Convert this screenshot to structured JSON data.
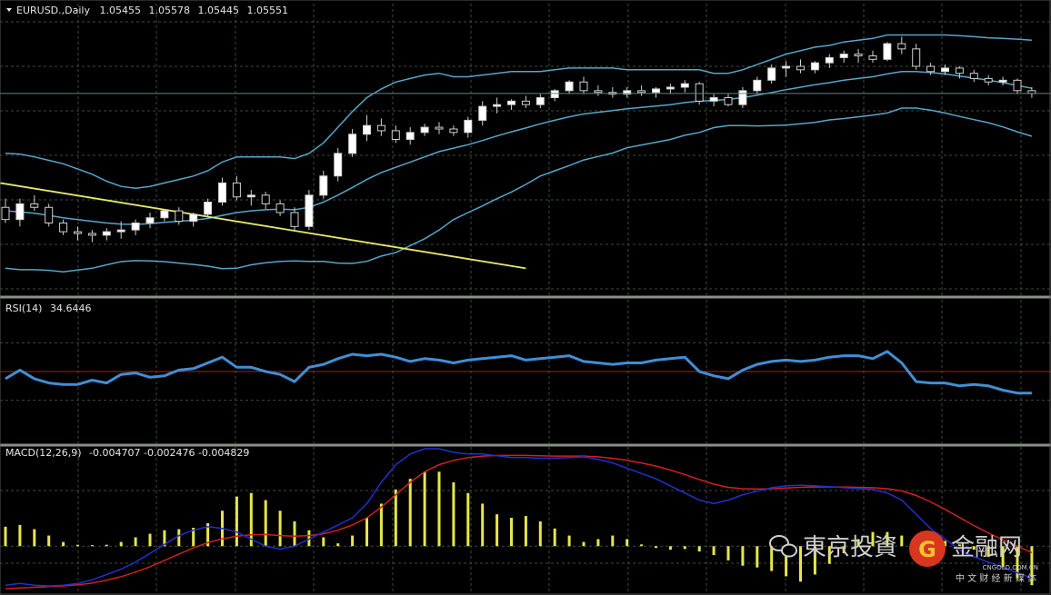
{
  "colors": {
    "background": "#000000",
    "grid": "#3c4a3c",
    "separator": "#8a8f8a",
    "bull_candle": "#ffffff",
    "bear_candle": "#000000",
    "wick": "#cfcfcf",
    "bollinger": "#56a6c9",
    "trendline": "#e6e66a",
    "rsi_line": "#3f8fd6",
    "rsi_level": "#b11b1b",
    "macd_hist": "#e6e64a",
    "macd_main": "#2030d0",
    "macd_signal": "#d02020"
  },
  "header": {
    "symbol_text": "EURUSD.,Daily",
    "open": "1.05455",
    "high": "1.05578",
    "low": "1.05445",
    "close": "1.05551"
  },
  "rsi_header": {
    "label": "RSI(14)",
    "value": "34.6446"
  },
  "macd_header": {
    "label": "MACD(12,26,9)",
    "values": "-0.004707 -0.002476 -0.004829"
  },
  "watermark": {
    "text_left": "東京投資",
    "text_right": "金融网",
    "site": "CNGOLD.COM.CN",
    "slogan": "中 文 财 经 新 媒 体",
    "icon": "wechat-icon"
  },
  "chart_data": [
    {
      "type": "candlestick",
      "panel": "price",
      "x_count": 72,
      "ylim": [
        1.028,
        1.112
      ],
      "candles": [
        [
          1.0535,
          1.056,
          1.049,
          1.05
        ],
        [
          1.05,
          1.056,
          1.048,
          1.0545
        ],
        [
          1.0545,
          1.057,
          1.0525,
          1.0535
        ],
        [
          1.0535,
          1.0545,
          1.048,
          1.049
        ],
        [
          1.049,
          1.05,
          1.0455,
          1.0465
        ],
        [
          1.0465,
          1.048,
          1.044,
          1.046
        ],
        [
          1.046,
          1.047,
          1.0435,
          1.0455
        ],
        [
          1.0455,
          1.0475,
          1.044,
          1.0465
        ],
        [
          1.0465,
          1.0495,
          1.0445,
          1.047
        ],
        [
          1.047,
          1.05,
          1.0455,
          1.049
        ],
        [
          1.049,
          1.052,
          1.0475,
          1.0505
        ],
        [
          1.0505,
          1.053,
          1.0495,
          1.0525
        ],
        [
          1.0525,
          1.0535,
          1.0485,
          1.0495
        ],
        [
          1.0495,
          1.052,
          1.048,
          1.0515
        ],
        [
          1.0515,
          1.056,
          1.0505,
          1.055
        ],
        [
          1.055,
          1.062,
          1.054,
          1.0605
        ],
        [
          1.0605,
          1.0625,
          1.0555,
          1.0565
        ],
        [
          1.0565,
          1.0585,
          1.054,
          1.057
        ],
        [
          1.057,
          1.058,
          1.053,
          1.0545
        ],
        [
          1.0545,
          1.0555,
          1.051,
          1.052
        ],
        [
          1.052,
          1.0535,
          1.047,
          1.048
        ],
        [
          1.048,
          1.0585,
          1.047,
          1.057
        ],
        [
          1.057,
          1.064,
          1.056,
          1.0625
        ],
        [
          1.0625,
          1.0705,
          1.061,
          1.069
        ],
        [
          1.069,
          1.076,
          1.068,
          1.0745
        ],
        [
          1.0745,
          1.08,
          1.0725,
          1.077
        ],
        [
          1.077,
          1.079,
          1.074,
          1.0755
        ],
        [
          1.0755,
          1.077,
          1.072,
          1.073
        ],
        [
          1.073,
          1.0765,
          1.0715,
          1.075
        ],
        [
          1.075,
          1.0775,
          1.074,
          1.0765
        ],
        [
          1.0765,
          1.078,
          1.0745,
          1.076
        ],
        [
          1.076,
          1.077,
          1.074,
          1.075
        ],
        [
          1.075,
          1.0795,
          1.0735,
          1.0785
        ],
        [
          1.0785,
          1.084,
          1.077,
          1.0825
        ],
        [
          1.0825,
          1.085,
          1.0805,
          1.083
        ],
        [
          1.083,
          1.0845,
          1.0815,
          1.084
        ],
        [
          1.084,
          1.0855,
          1.082,
          1.083
        ],
        [
          1.083,
          1.086,
          1.082,
          1.085
        ],
        [
          1.085,
          1.0875,
          1.084,
          1.087
        ],
        [
          1.087,
          1.09,
          1.086,
          1.0895
        ],
        [
          1.0895,
          1.091,
          1.086,
          1.087
        ],
        [
          1.087,
          1.0885,
          1.0855,
          1.0865
        ],
        [
          1.0865,
          1.088,
          1.085,
          1.086
        ],
        [
          1.086,
          1.088,
          1.085,
          1.087
        ],
        [
          1.087,
          1.0885,
          1.0855,
          1.0865
        ],
        [
          1.0865,
          1.088,
          1.085,
          1.0875
        ],
        [
          1.0875,
          1.089,
          1.086,
          1.088
        ],
        [
          1.088,
          1.09,
          1.0865,
          1.089
        ],
        [
          1.089,
          1.0895,
          1.083,
          1.084
        ],
        [
          1.084,
          1.086,
          1.0825,
          1.085
        ],
        [
          1.085,
          1.086,
          1.0825,
          1.083
        ],
        [
          1.083,
          1.088,
          1.082,
          1.087
        ],
        [
          1.087,
          1.091,
          1.086,
          1.09
        ],
        [
          1.09,
          1.0945,
          1.089,
          1.0935
        ],
        [
          1.0935,
          1.0955,
          1.091,
          1.094
        ],
        [
          1.094,
          1.096,
          1.092,
          1.093
        ],
        [
          1.093,
          1.0955,
          1.092,
          1.095
        ],
        [
          1.095,
          1.0975,
          1.0935,
          1.0965
        ],
        [
          1.0965,
          1.0985,
          1.095,
          1.0975
        ],
        [
          1.0975,
          1.099,
          1.095,
          1.097
        ],
        [
          1.097,
          1.0985,
          1.095,
          1.096
        ],
        [
          1.096,
          1.101,
          1.0955,
          1.1005
        ],
        [
          1.1005,
          1.1025,
          1.0975,
          1.099
        ],
        [
          1.099,
          1.1005,
          1.093,
          1.094
        ],
        [
          1.094,
          1.095,
          1.0915,
          1.0925
        ],
        [
          1.0925,
          1.0945,
          1.0915,
          1.0935
        ],
        [
          1.0935,
          1.094,
          1.0905,
          1.092
        ],
        [
          1.092,
          1.093,
          1.0895,
          1.0905
        ],
        [
          1.0905,
          1.0915,
          1.0885,
          1.0895
        ],
        [
          1.0895,
          1.091,
          1.0885,
          1.09
        ],
        [
          1.09,
          1.0905,
          1.086,
          1.087
        ],
        [
          1.087,
          1.088,
          1.085,
          1.0862
        ]
      ],
      "bollinger_upper": [
        1.069,
        1.0688,
        1.068,
        1.067,
        1.066,
        1.0645,
        1.063,
        1.061,
        1.0595,
        1.059,
        1.0595,
        1.0605,
        1.0615,
        1.0625,
        1.064,
        1.0665,
        1.068,
        1.068,
        1.068,
        1.068,
        1.0675,
        1.069,
        1.072,
        1.0765,
        1.081,
        1.085,
        1.0875,
        1.0895,
        1.0905,
        1.0915,
        1.092,
        1.091,
        1.091,
        1.0915,
        1.092,
        1.0925,
        1.0925,
        1.0925,
        1.093,
        1.0935,
        1.0935,
        1.0935,
        1.0935,
        1.093,
        1.093,
        1.093,
        1.093,
        1.093,
        1.093,
        1.092,
        1.092,
        1.093,
        1.0945,
        1.096,
        1.0975,
        1.0985,
        1.0995,
        1.1,
        1.101,
        1.1015,
        1.102,
        1.103,
        1.103,
        1.103,
        1.103,
        1.103,
        1.1028,
        1.1025,
        1.1022,
        1.102,
        1.1018,
        1.1015
      ],
      "bollinger_middle": [
        1.0525,
        1.0522,
        1.0518,
        1.0512,
        1.0505,
        1.05,
        1.0495,
        1.049,
        1.0487,
        1.0486,
        1.0488,
        1.0492,
        1.0495,
        1.0498,
        1.0503,
        1.0512,
        1.052,
        1.0525,
        1.0528,
        1.053,
        1.0528,
        1.0535,
        1.055,
        1.057,
        1.0592,
        1.0615,
        1.0635,
        1.065,
        1.0665,
        1.068,
        1.0695,
        1.0705,
        1.0715,
        1.0727,
        1.074,
        1.0752,
        1.0763,
        1.0775,
        1.0785,
        1.0795,
        1.0803,
        1.0808,
        1.0813,
        1.0818,
        1.0822,
        1.0826,
        1.083,
        1.0836,
        1.084,
        1.0842,
        1.0845,
        1.085,
        1.0857,
        1.0865,
        1.0873,
        1.088,
        1.0887,
        1.0893,
        1.09,
        1.0905,
        1.091,
        1.0918,
        1.0925,
        1.0925,
        1.0922,
        1.0918,
        1.0912,
        1.0906,
        1.09,
        1.0893,
        1.0885,
        1.0877
      ],
      "bollinger_lower": [
        1.036,
        1.0356,
        1.0356,
        1.0354,
        1.035,
        1.0355,
        1.036,
        1.037,
        1.0379,
        1.0382,
        1.0381,
        1.0379,
        1.0375,
        1.0371,
        1.0366,
        1.0359,
        1.036,
        1.037,
        1.0376,
        1.038,
        1.0381,
        1.038,
        1.038,
        1.0375,
        1.0374,
        1.038,
        1.0395,
        1.0405,
        1.0425,
        1.0445,
        1.047,
        1.05,
        1.052,
        1.0539,
        1.056,
        1.0579,
        1.0601,
        1.0625,
        1.064,
        1.0655,
        1.0671,
        1.0681,
        1.0691,
        1.0706,
        1.0714,
        1.0722,
        1.073,
        1.0742,
        1.075,
        1.0764,
        1.077,
        1.077,
        1.0769,
        1.077,
        1.0771,
        1.0775,
        1.0779,
        1.0786,
        1.079,
        1.0795,
        1.08,
        1.0806,
        1.082,
        1.082,
        1.0814,
        1.0806,
        1.0796,
        1.0787,
        1.0778,
        1.0766,
        1.0752,
        1.0739
      ],
      "trendline": {
        "from": [
          0,
          1.0605
        ],
        "to": [
          36,
          1.036
        ]
      }
    },
    {
      "type": "line",
      "panel": "rsi",
      "ylim": [
        0,
        100
      ],
      "level": 50,
      "levels_dotted": [
        30,
        70
      ],
      "values": [
        45,
        51,
        45,
        42,
        41,
        41,
        44,
        42,
        48,
        49,
        46,
        47,
        51,
        52,
        56,
        60,
        53,
        53,
        50,
        48,
        43,
        53,
        55,
        59,
        62,
        61,
        62,
        60,
        57,
        59,
        58,
        56,
        58,
        59,
        60,
        61,
        58,
        59,
        60,
        61,
        57,
        56,
        55,
        56,
        56,
        58,
        59,
        60,
        50,
        47,
        45,
        51,
        55,
        57,
        58,
        57,
        58,
        60,
        61,
        61,
        59,
        64,
        56,
        43,
        42,
        42,
        40,
        41,
        40,
        37,
        35,
        35
      ]
    },
    {
      "type": "bar",
      "panel": "macd",
      "ylim": [
        -0.013,
        0.028
      ],
      "histogram": [
        0.0055,
        0.006,
        0.0048,
        0.003,
        0.0012,
        0.0004,
        0.0003,
        0.0004,
        0.0012,
        0.0025,
        0.0035,
        0.0045,
        0.0048,
        0.0052,
        0.0065,
        0.01,
        0.014,
        0.015,
        0.013,
        0.01,
        0.007,
        0.0045,
        0.0025,
        0.0008,
        0.003,
        0.008,
        0.012,
        0.016,
        0.019,
        0.021,
        0.021,
        0.018,
        0.015,
        0.012,
        0.009,
        0.008,
        0.0085,
        0.007,
        0.005,
        0.003,
        0.0012,
        0.002,
        0.003,
        0.002,
        0.0005,
        -0.0005,
        -0.001,
        -0.0008,
        -0.0015,
        -0.0025,
        -0.004,
        -0.0055,
        -0.006,
        -0.007,
        -0.0085,
        -0.01,
        -0.008,
        -0.005,
        -0.002,
        0.002,
        0.004,
        0.004,
        0.003,
        0.0025,
        0.002,
        0.0015,
        0.0005,
        -0.001,
        -0.003,
        -0.006,
        -0.009,
        -0.011
      ],
      "main": [
        -0.011,
        -0.0105,
        -0.011,
        -0.0112,
        -0.011,
        -0.0105,
        -0.0095,
        -0.008,
        -0.0065,
        -0.0045,
        -0.002,
        0.0005,
        0.003,
        0.0045,
        0.0055,
        0.005,
        0.004,
        0.002,
        0.0,
        -0.0008,
        0.0,
        0.002,
        0.004,
        0.006,
        0.008,
        0.012,
        0.018,
        0.023,
        0.026,
        0.0275,
        0.0275,
        0.0265,
        0.026,
        0.026,
        0.0255,
        0.025,
        0.025,
        0.0248,
        0.0248,
        0.025,
        0.0252,
        0.0245,
        0.0235,
        0.022,
        0.0205,
        0.019,
        0.017,
        0.015,
        0.013,
        0.012,
        0.013,
        0.0145,
        0.0155,
        0.0165,
        0.017,
        0.0172,
        0.017,
        0.0168,
        0.0165,
        0.0162,
        0.016,
        0.015,
        0.013,
        0.009,
        0.005,
        0.002,
        -0.001,
        -0.003,
        -0.0045,
        -0.006,
        -0.0075,
        -0.009
      ],
      "signal": [
        -0.012,
        -0.0118,
        -0.0116,
        -0.0114,
        -0.0112,
        -0.0109,
        -0.0104,
        -0.0096,
        -0.0086,
        -0.0073,
        -0.0058,
        -0.004,
        -0.0022,
        -0.0005,
        0.001,
        0.0021,
        0.0028,
        0.0032,
        0.0033,
        0.003,
        0.0028,
        0.003,
        0.0035,
        0.0045,
        0.006,
        0.008,
        0.011,
        0.0145,
        0.018,
        0.021,
        0.023,
        0.0242,
        0.025,
        0.0254,
        0.0256,
        0.0256,
        0.0256,
        0.0255,
        0.0254,
        0.0254,
        0.0254,
        0.0252,
        0.0248,
        0.0242,
        0.0235,
        0.0226,
        0.0215,
        0.0202,
        0.0188,
        0.0175,
        0.0166,
        0.0162,
        0.0161,
        0.0162,
        0.0164,
        0.0166,
        0.0167,
        0.0167,
        0.0167,
        0.0166,
        0.0165,
        0.0162,
        0.0156,
        0.0143,
        0.0125,
        0.0104,
        0.0081,
        0.0058,
        0.0037,
        0.0018,
        0.0,
        -0.0018
      ]
    }
  ]
}
